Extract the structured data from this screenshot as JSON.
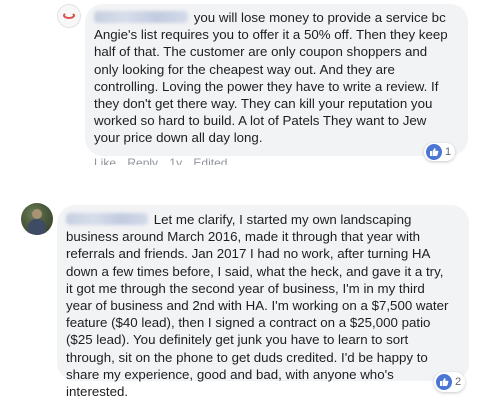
{
  "comments": [
    {
      "text": "you will lose money to provide a service bc Angie's list requires you to offer it a 50% off. Then they keep half of that. The customer are only coupon shoppers and only looking for the cheapest way out. And they are controlling. Loving the power they have to write a review. If they don't get there way. They can kill your reputation you worked so hard to build. A lot of Patels They want to Jew your price down all day long.",
      "reaction_count": "1",
      "actions": [
        "Like",
        "Reply",
        "1y",
        "Edited"
      ]
    },
    {
      "text": "Let me clarify, I started my own landscaping business around March 2016, made it through that year with referrals and friends. Jan 2017 I had no work, after turning HA down a few times before, I said, what the heck, and gave it a try, it got me through the second year of business, I'm in my third year of business and 2nd with HA. I'm working on a $7,500 water feature ($40 lead), then I signed a contract on a $25,000 patio ($25 lead). You definitely get junk you have to learn to sort through, sit on the phone to get duds credited. I'd be happy to share my experience, good and bad, with anyone who's interested.",
      "reaction_count": "2"
    }
  ],
  "icons": {
    "reaction": "like-icon"
  },
  "colors": {
    "bubble": "#f2f3f5",
    "like": "#4b76d6",
    "meta": "#90949c"
  }
}
